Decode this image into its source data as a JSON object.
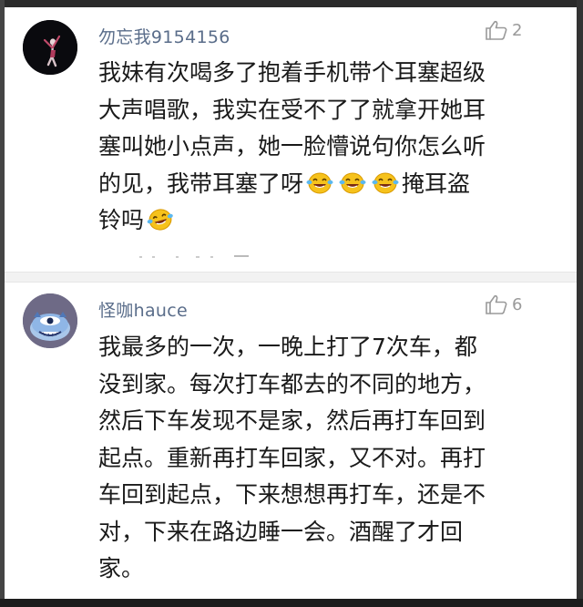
{
  "comments": [
    {
      "username": "勿忘我9154156",
      "like_count": "2",
      "lines": [
        "我妹有次喝多了抱着手机带个耳塞超级",
        "大声唱歌，我实在受不了了就拿开她耳",
        "塞叫她小点声，她一脸懵说句你怎么听"
      ],
      "line4_prefix": "的见，我带耳塞了呀",
      "line4_suffix": "掩耳盗",
      "line5_prefix": "铃吗",
      "avatar": "dark-photo-avatar",
      "emoji_icon": "laughing-tears-emoji"
    },
    {
      "username": "怪咖hauce",
      "like_count": "6",
      "lines": [
        "我最多的一次，一晚上打了7次车，都",
        "没到家。每次打车都去的不同的地方，",
        "然后下车发现不是家，然后再打车回到",
        "起点。重新再打车回家，又不对。再打",
        "车回到起点，下来想想再打车，还是不",
        "对，下来在路边睡一会。酒醒了才回",
        "家。"
      ],
      "avatar": "blue-monster-avatar"
    }
  ],
  "colors": {
    "username": "#5a6d8a",
    "body_text": "#1a1a1a",
    "like": "#9a9a9a",
    "divider": "#f2f2f2"
  },
  "icons": [
    "thumbs-up-icon",
    "laughing-tears-emoji"
  ]
}
